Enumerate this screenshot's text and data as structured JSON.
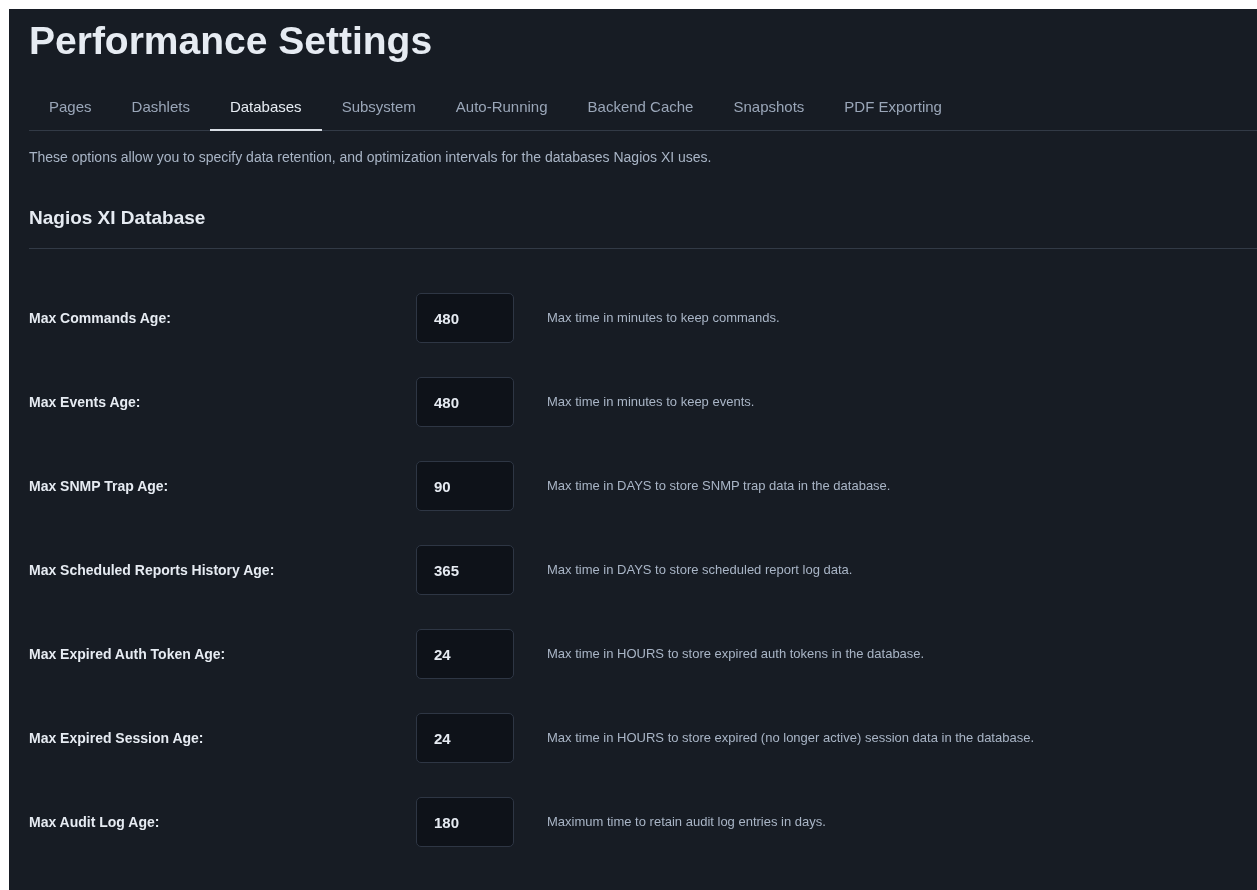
{
  "title": "Performance Settings",
  "tabs": [
    {
      "label": "Pages",
      "selected": false
    },
    {
      "label": "Dashlets",
      "selected": false
    },
    {
      "label": "Databases",
      "selected": true
    },
    {
      "label": "Subsystem",
      "selected": false
    },
    {
      "label": "Auto-Running",
      "selected": false
    },
    {
      "label": "Backend Cache",
      "selected": false
    },
    {
      "label": "Snapshots",
      "selected": false
    },
    {
      "label": "PDF Exporting",
      "selected": false
    }
  ],
  "description": "These options allow you to specify data retention, and optimization intervals for the databases Nagios XI uses.",
  "section_title": "Nagios XI Database",
  "settings": [
    {
      "label": "Max Commands Age:",
      "value": "480",
      "help": "Max time in minutes to keep commands."
    },
    {
      "label": "Max Events Age:",
      "value": "480",
      "help": "Max time in minutes to keep events."
    },
    {
      "label": "Max SNMP Trap Age:",
      "value": "90",
      "help": "Max time in DAYS to store SNMP trap data in the database."
    },
    {
      "label": "Max Scheduled Reports History Age:",
      "value": "365",
      "help": "Max time in DAYS to store scheduled report log data."
    },
    {
      "label": "Max Expired Auth Token Age:",
      "value": "24",
      "help": "Max time in HOURS to store expired auth tokens in the database."
    },
    {
      "label": "Max Expired Session Age:",
      "value": "24",
      "help": "Max time in HOURS to store expired (no longer active) session data in the database."
    },
    {
      "label": "Max Audit Log Age:",
      "value": "180",
      "help": "Maximum time to retain audit log entries in days."
    }
  ]
}
